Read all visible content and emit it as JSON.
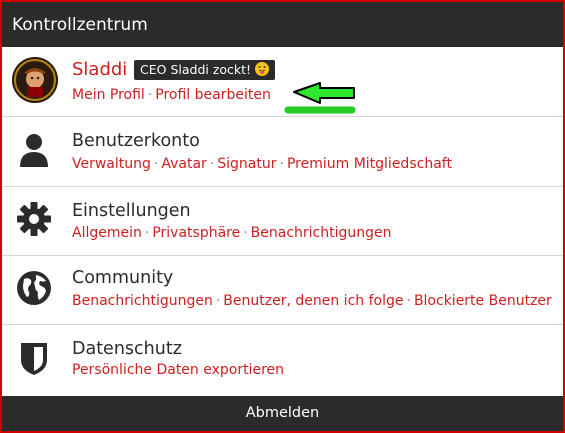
{
  "header": {
    "title": "Kontrollzentrum"
  },
  "profile": {
    "username": "Sladdi",
    "banner": "CEO Sladdi zockt!",
    "banner_emoji": "tongue-out-emoji",
    "links": [
      "Mein Profil",
      "Profil bearbeiten"
    ]
  },
  "sections": [
    {
      "title": "Benutzerkonto",
      "icon": "user-icon",
      "links": [
        "Verwaltung",
        "Avatar",
        "Signatur",
        "Premium Mitgliedschaft"
      ]
    },
    {
      "title": "Einstellungen",
      "icon": "gear-icon",
      "links": [
        "Allgemein",
        "Privatsphäre",
        "Benachrichtigungen"
      ]
    },
    {
      "title": "Community",
      "icon": "globe-icon",
      "links": [
        "Benachrichtigungen",
        "Benutzer, denen ich folge",
        "Blockierte Benutzer"
      ]
    },
    {
      "title": "Datenschutz",
      "icon": "shield-icon",
      "links": [
        "Persönliche Daten exportieren"
      ]
    }
  ],
  "footer": {
    "logout_label": "Abmelden"
  },
  "colors": {
    "accent": "#cc1f1f",
    "header_bg": "#2b2b2b",
    "border": "#d40000",
    "annotation_arrow": "#22cc22"
  }
}
